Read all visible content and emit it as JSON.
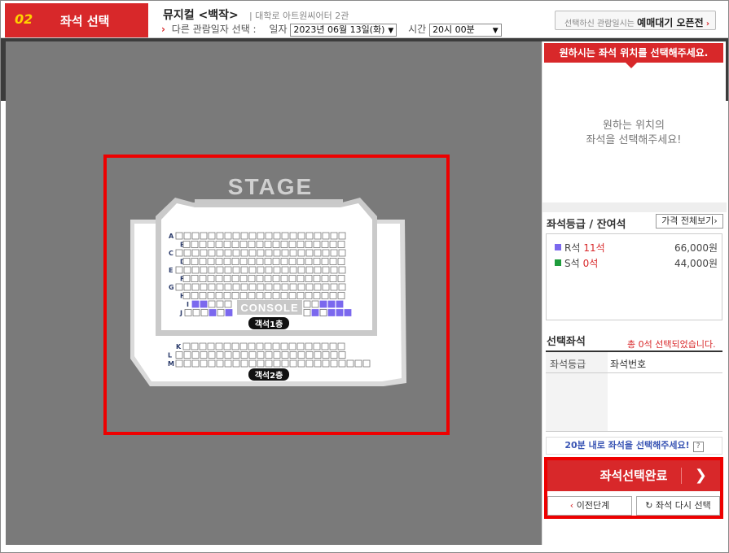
{
  "header": {
    "step_number": "02",
    "step_title": "좌석 선택",
    "show_title": "뮤지컬 <백작>",
    "venue": "| 대학로 아트원씨어터 2관",
    "other_date_label": "다른 관람일자 선택 :",
    "date_label": "일자",
    "date_value": "2023년 06월 13일(화)",
    "time_label": "시간",
    "time_value": "20시 00분",
    "wait_prefix": "선택하신 관람일시는",
    "wait_label": "예매대기 오픈전"
  },
  "seatmap": {
    "stage_label": "STAGE",
    "console_label": "CONSOLE",
    "floor1_label": "객석1층",
    "floor2_label": "객석2층",
    "rows_floor1": [
      "A",
      "B",
      "C",
      "D",
      "E",
      "F",
      "G",
      "H",
      "I",
      "J"
    ],
    "rows_floor2": [
      "K",
      "L",
      "M"
    ]
  },
  "panel": {
    "header": "원하시는 좌석 위치를 선택해주세요.",
    "hint_line1": "원하는 위치의",
    "hint_line2": "좌석을 선택해주세요!",
    "grade_title": "좌석등급 / 잔여석",
    "price_all_button": "가격 전체보기",
    "grades": [
      {
        "name": "R석",
        "count": "11석",
        "price": "66,000원",
        "color": "#7b68ee"
      },
      {
        "name": "S석",
        "count": "0석",
        "price": "44,000원",
        "color": "#1e9c3c"
      }
    ],
    "selected_title": "선택좌석",
    "selected_count": "총 0석 선택되었습니다.",
    "col_grade": "좌석등급",
    "col_seat": "좌석번호",
    "timer_text": "20분 내로 좌석을 선택해주세요!",
    "help_icon_text": "?",
    "done_button": "좌석선택완료",
    "prev_button": "이전단계",
    "reset_button": "좌석 다시 선택"
  },
  "colors": {
    "accent_red": "#d8282a",
    "seat_available": "#7b68ee",
    "map_background": "#7a7a7a"
  }
}
